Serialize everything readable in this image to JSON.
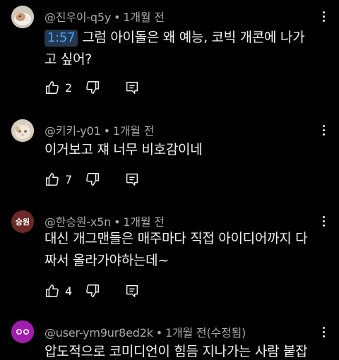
{
  "comments": [
    {
      "handle": "@진우이-q5y",
      "age": "1개월 전",
      "edited": "",
      "timestamp": "1:57",
      "text_line1": "그럼 아이돌은 왜 예능, 코빅 개콘에 나가",
      "text_line2": "고 싶어?",
      "likes": "2",
      "avatar": "hamster-photo",
      "avatar_text": ""
    },
    {
      "handle": "@키키-y01",
      "age": "1개월 전",
      "edited": "",
      "timestamp": "",
      "text_line1": "이거보고 쟤 너무 비호감이네",
      "text_line2": "",
      "likes": "7",
      "avatar": "cat-photo",
      "avatar_text": ""
    },
    {
      "handle": "@한승원-x5n",
      "age": "1개월 전",
      "edited": "",
      "timestamp": "",
      "text_line1": "대신 개그맨들은 매주마다 직접 아이디어까지 다",
      "text_line2": "짜서 올라가야하는데~",
      "likes": "4",
      "avatar": "initials",
      "avatar_text": "승원"
    },
    {
      "handle": "@user-ym9ur8ed2k",
      "age": "1개월 전",
      "edited": "(수정됨)",
      "timestamp": "",
      "text_line1": "압도적으로 코미디언이 힘듬 지나가는 사람 붙잡",
      "text_line2": "",
      "likes": "",
      "avatar": "face-default",
      "avatar_text": ""
    }
  ],
  "icons": {
    "like": "thumbs-up-icon",
    "dislike": "thumbs-down-icon",
    "reply": "reply-icon",
    "more": "more-vert-icon"
  },
  "colors": {
    "background": "#000000",
    "text": "#f1f1f1",
    "meta": "#aaaaaa",
    "timestamp_link": "#3ea6ff",
    "avatar_initials_bg": "#6b2a28",
    "avatar_default_bg": "#a21caf"
  }
}
